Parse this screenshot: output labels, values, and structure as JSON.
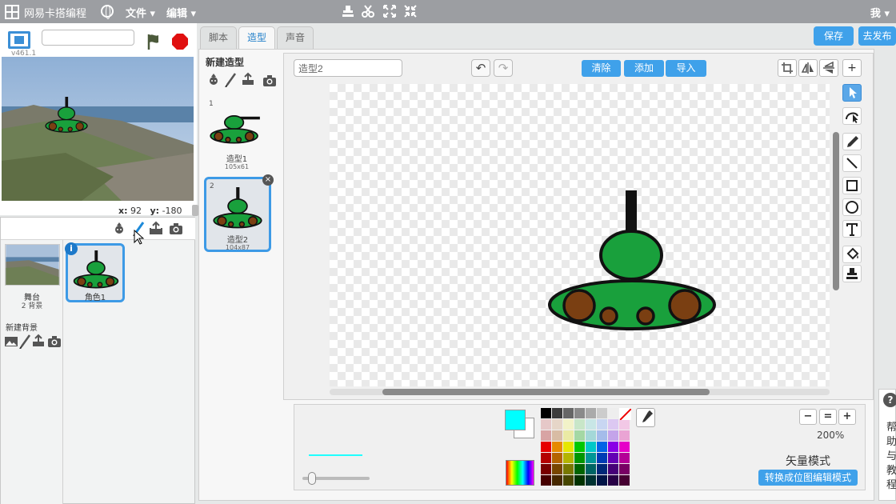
{
  "topbar": {
    "brand": "网易卡搭编程",
    "menu_file": "文件",
    "menu_edit": "编辑",
    "user": "我"
  },
  "stage": {
    "version": "v461.1",
    "project_name": "",
    "coord_x_label": "x:",
    "coord_x": "92",
    "coord_y_label": "y:",
    "coord_y": "-180"
  },
  "sprites": {
    "stage_label": "舞台",
    "stage_backdrops": "2 背景",
    "new_backdrop_label": "新建背景",
    "items": [
      {
        "name": "角色1",
        "info": "i"
      }
    ]
  },
  "tabs": [
    {
      "label": "脚本"
    },
    {
      "label": "造型"
    },
    {
      "label": "声音"
    }
  ],
  "actions": {
    "save": "保存",
    "publish": "去发布"
  },
  "costumes": {
    "header": "新建造型",
    "items": [
      {
        "num": "1",
        "name": "造型1",
        "size": "105x61"
      },
      {
        "num": "2",
        "name": "造型2",
        "size": "104x87",
        "close": "×"
      }
    ]
  },
  "editor": {
    "costume_name": "造型2",
    "undo": "↶",
    "redo": "↷",
    "clear": "清除",
    "add": "添加",
    "import": "导入",
    "plus": "+",
    "zoom_value": "200%",
    "mode": "矢量模式",
    "convert": "转换成位图编辑模式",
    "zoom_out": "−",
    "zoom_reset": "=",
    "zoom_in": "+"
  },
  "colors": {
    "foreground": "#00ffff",
    "background": "#ffffff",
    "accent": "#3fa1ea"
  },
  "palette": [
    "#000000",
    "#3c3c3c",
    "#666666",
    "#8a8a8a",
    "#aaaaaa",
    "#cccccc",
    "#eeeeee",
    "#ffffff",
    "#e6c8c8",
    "#e6d6c8",
    "#f2f2c8",
    "#c8e6c8",
    "#c8e6e6",
    "#c8d6f2",
    "#dcc8f2",
    "#f2c8e6",
    "#d8a4a4",
    "#d8bca4",
    "#eaeaa4",
    "#a4d8a4",
    "#a4d8d8",
    "#a4bcea",
    "#c4a4ea",
    "#eaa4d4",
    "#e60000",
    "#e68a00",
    "#e6e600",
    "#00c800",
    "#00c8c8",
    "#0064e6",
    "#8a00e6",
    "#e600c8",
    "#b40000",
    "#b46400",
    "#b4b400",
    "#009600",
    "#009696",
    "#003cb4",
    "#6400b4",
    "#b40096",
    "#780000",
    "#784600",
    "#787800",
    "#006400",
    "#006464",
    "#002878",
    "#460078",
    "#780064",
    "#460000",
    "#462800",
    "#464600",
    "#003200",
    "#003232",
    "#001446",
    "#280046",
    "#460032"
  ],
  "help": {
    "icon": "?",
    "text": "帮助与教程"
  }
}
